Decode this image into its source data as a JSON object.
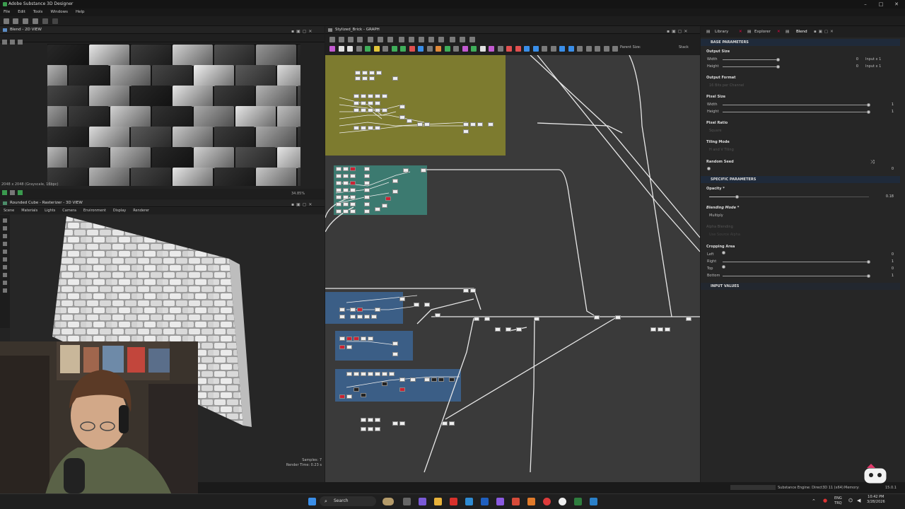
{
  "app": {
    "title": "Adobe Substance 3D Designer"
  },
  "menu": [
    "File",
    "Edit",
    "Tools",
    "Windows",
    "Help"
  ],
  "panel2d": {
    "title": "Blend - 2D VIEW",
    "status": "2048 x 2048 (Grayscale, 16bpc)",
    "zoom": "34.85%"
  },
  "panel3d": {
    "title": "Rounded Cube - Rasterizer - 3D VIEW",
    "menu": [
      "Scene",
      "Materials",
      "Lights",
      "Camera",
      "Environment",
      "Display",
      "Renderer"
    ],
    "samples": "Samples: 7",
    "render_time": "Render Time: 0.23 s"
  },
  "graph": {
    "title": "Stylized_Brick - GRAPH",
    "parent_size": "Parent Size:",
    "stack": "Stack"
  },
  "right_tabs": {
    "library": "Library",
    "explorer": "Explorer",
    "blend": "Blend"
  },
  "props": {
    "base_section": "BASE PARAMETERS",
    "output_size": "Output Size",
    "width": "Width",
    "height": "Height",
    "output_size_width_val": "0",
    "output_size_height_val": "0",
    "input_x1": "Input x 1",
    "output_size_level": 0.5,
    "output_format": "Output Format",
    "output_format_val": "16 Bits per Channel",
    "pixel_size": "Pixel Size",
    "pixel_w_val": "1",
    "pixel_h_val": "1",
    "pixel_size_level": 1.0,
    "pixel_ratio": "Pixel Ratio",
    "pixel_ratio_val": "Square",
    "tiling_mode": "Tiling Mode",
    "tiling_mode_val": "H and V Tiling",
    "random_seed": "Random Seed",
    "random_seed_val": "0",
    "specific_section": "SPECIFIC PARAMETERS",
    "opacity": "Opacity *",
    "opacity_val": "0.18",
    "blending_mode": "Blending Mode *",
    "blending_mode_val": "Multiply",
    "alpha_blending": "Alpha Blending",
    "alpha_blending_val": "Use Source Alpha",
    "cropping_area": "Cropping Area",
    "left": "Left",
    "right": "Right",
    "top": "Top",
    "bottom": "Bottom",
    "left_val": "0",
    "right_val": "1",
    "top_val": "0",
    "bottom_val": "1",
    "input_values": "INPUT VALUES"
  },
  "status": {
    "engine": "Substance Engine: Direct3D 11 (x64)",
    "memory": "Memory:",
    "version": "15.0.1"
  },
  "taskbar": {
    "search": "Search",
    "time": "10:42 PM",
    "date": "3/28/2026",
    "lang1": "ENG",
    "lang2": "TRQ"
  },
  "colors": {
    "frame_yellow": "#7d7b2f",
    "frame_teal": "#3c7a70",
    "frame_blue": "#3b5e86",
    "section_bg": "#1f2a3a"
  }
}
